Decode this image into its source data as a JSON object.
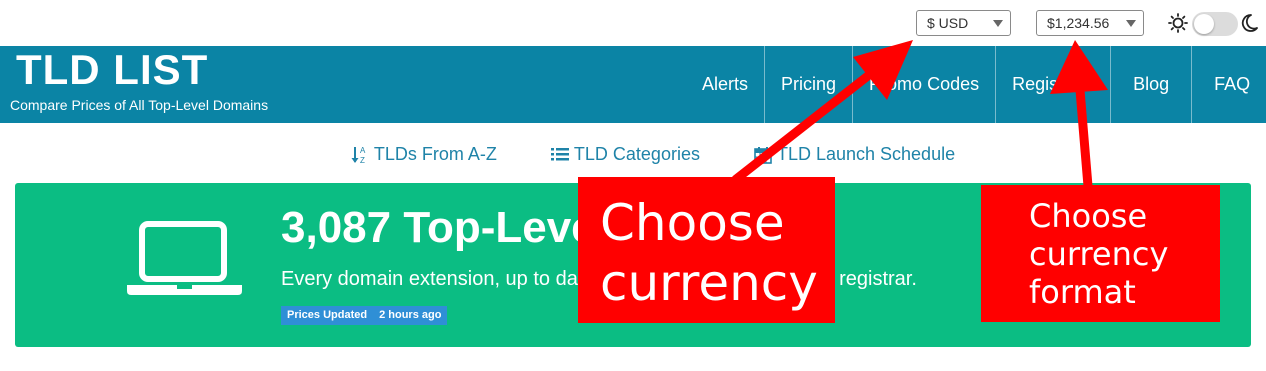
{
  "topbar": {
    "currency": "$ USD",
    "format": "$1,234.56",
    "theme_light_icon": "sun-icon",
    "theme_dark_icon": "moon-icon"
  },
  "header": {
    "logo": "TLD LIST",
    "tagline": "Compare Prices of All Top-Level Domains",
    "nav": [
      "Alerts",
      "Pricing",
      "Promo Codes",
      "Registrars",
      "Blog",
      "FAQ"
    ]
  },
  "sublinks": [
    {
      "label": "TLDs From A-Z",
      "icon": "sort-alpha-icon"
    },
    {
      "label": "TLD Categories",
      "icon": "list-icon"
    },
    {
      "label": "TLD Launch Schedule",
      "icon": "calendar-icon"
    }
  ],
  "hero": {
    "title": "3,087 Top-Level Domains",
    "subtitle": "Every domain extension, up to date prices. Find the best value registrar.",
    "badge_label": "Prices Updated",
    "badge_value": "2 hours ago",
    "icon": "laptop-icon"
  },
  "annotations": {
    "currency_line1": "Choose",
    "currency_line2": "currency",
    "format_line1": "Choose",
    "format_line2": "currency",
    "format_line3": "format"
  },
  "colors": {
    "header_bg": "#0b84a5",
    "hero_bg": "#0bbd83",
    "annotation": "#ff0000",
    "link": "#1f83a8"
  }
}
